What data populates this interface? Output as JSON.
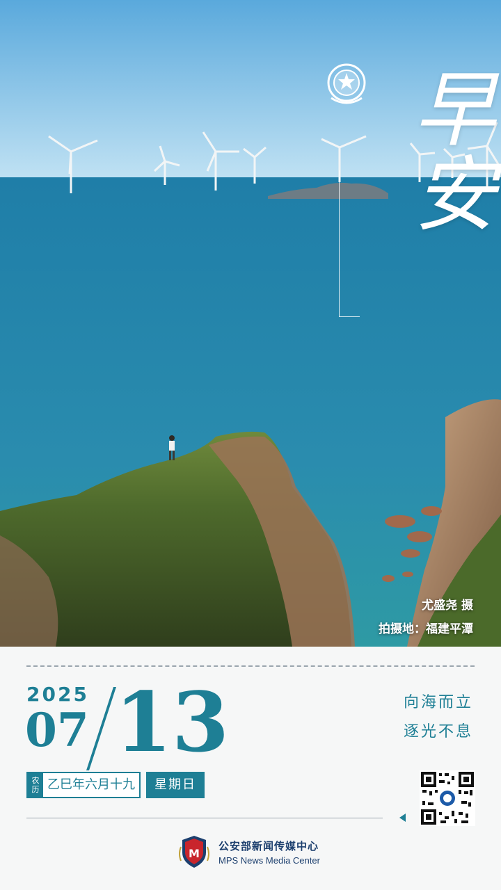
{
  "title": "早安",
  "emblem": "police-emblem-icon",
  "photo": {
    "credit_photographer": "尤盛尧  摄",
    "credit_location": "拍摄地：福建平潭"
  },
  "date": {
    "year": "2025",
    "month": "07",
    "day": "13",
    "lunar_tag": "农历",
    "lunar_date": "乙巳年六月十九",
    "weekday": "星期日"
  },
  "motto": {
    "line1": "向海而立",
    "line2": "逐光不息"
  },
  "qr_code": "qr-code-icon",
  "brand": {
    "name_cn": "公安部新闻传媒中心",
    "name_en": "MPS News Media Center",
    "logo": "mps-shield-logo-icon"
  },
  "colors": {
    "accent": "#1e7f95",
    "brand": "#1c3f6e",
    "sky": "#8cc6ea",
    "sea": "#2583a7"
  }
}
